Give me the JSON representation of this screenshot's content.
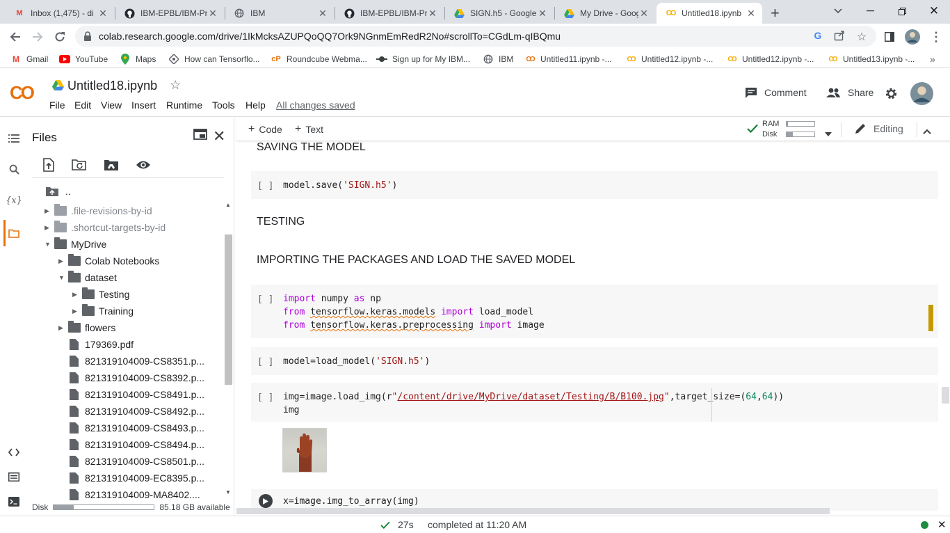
{
  "browser": {
    "tabs": [
      {
        "label": "Inbox (1,475) - di",
        "icon": "gmail-icon"
      },
      {
        "label": "IBM-EPBL/IBM-Pr",
        "icon": "github-icon"
      },
      {
        "label": "IBM",
        "icon": "globe-icon"
      },
      {
        "label": "IBM-EPBL/IBM-Pr",
        "icon": "github-icon"
      },
      {
        "label": "SIGN.h5 - Google",
        "icon": "drive-icon"
      },
      {
        "label": "My Drive - Googl",
        "icon": "drive-icon"
      },
      {
        "label": "Untitled18.ipynb",
        "icon": "colab-icon",
        "active": true
      }
    ],
    "url": "colab.research.google.com/drive/1IkMcksAZUPQoQQ7Ork9NGnmEmRedR2No#scrollTo=CGdLm-qIBQmu"
  },
  "bookmarks": [
    {
      "label": "Gmail",
      "icon": "gmail-icon"
    },
    {
      "label": "YouTube",
      "icon": "youtube-icon"
    },
    {
      "label": "Maps",
      "icon": "maps-icon"
    },
    {
      "label": "How can Tensorflo...",
      "icon": "tensorflow-icon"
    },
    {
      "label": "Roundcube Webma...",
      "icon": "roundcube-icon"
    },
    {
      "label": "Sign up for My IBM...",
      "icon": "ibm-icon"
    },
    {
      "label": "IBM",
      "icon": "globe-icon"
    },
    {
      "label": "Untitled11.ipynb -...",
      "icon": "colab-icon"
    },
    {
      "label": "Untitled12.ipynb -...",
      "icon": "colab-icon"
    },
    {
      "label": "Untitled12.ipynb -...",
      "icon": "colab-icon"
    },
    {
      "label": "Untitled13.ipynb -...",
      "icon": "colab-icon"
    }
  ],
  "colab": {
    "logo": "CO",
    "title": "Untitled18.ipynb",
    "menu": [
      "File",
      "Edit",
      "View",
      "Insert",
      "Runtime",
      "Tools",
      "Help"
    ],
    "saved_status": "All changes saved",
    "comment_label": "Comment",
    "share_label": "Share"
  },
  "files": {
    "title": "Files",
    "parent": "..",
    "tree": [
      {
        "label": ".file-revisions-by-id",
        "type": "folder",
        "depth": 0,
        "expanded": false,
        "dim": true
      },
      {
        "label": ".shortcut-targets-by-id",
        "type": "folder",
        "depth": 0,
        "expanded": false,
        "dim": true
      },
      {
        "label": "MyDrive",
        "type": "folder",
        "depth": 0,
        "expanded": true
      },
      {
        "label": "Colab Notebooks",
        "type": "folder",
        "depth": 1,
        "expanded": false
      },
      {
        "label": "dataset",
        "type": "folder",
        "depth": 1,
        "expanded": true
      },
      {
        "label": "Testing",
        "type": "folder",
        "depth": 2,
        "expanded": false
      },
      {
        "label": "Training",
        "type": "folder",
        "depth": 2,
        "expanded": false
      },
      {
        "label": "flowers",
        "type": "folder",
        "depth": 1,
        "expanded": false
      },
      {
        "label": "179369.pdf",
        "type": "file",
        "depth": 1
      },
      {
        "label": "821319104009-CS8351.p...",
        "type": "file",
        "depth": 1
      },
      {
        "label": "821319104009-CS8392.p...",
        "type": "file",
        "depth": 1
      },
      {
        "label": "821319104009-CS8491.p...",
        "type": "file",
        "depth": 1
      },
      {
        "label": "821319104009-CS8492.p...",
        "type": "file",
        "depth": 1
      },
      {
        "label": "821319104009-CS8493.p...",
        "type": "file",
        "depth": 1
      },
      {
        "label": "821319104009-CS8494.p...",
        "type": "file",
        "depth": 1
      },
      {
        "label": "821319104009-CS8501.p...",
        "type": "file",
        "depth": 1
      },
      {
        "label": "821319104009-EC8395.p...",
        "type": "file",
        "depth": 1
      },
      {
        "label": "821319104009-MA8402....",
        "type": "file",
        "depth": 1
      }
    ],
    "disk_label": "Disk",
    "disk_fraction": 0.2,
    "disk_available": "85.18 GB available"
  },
  "toolbar": {
    "code_label": "Code",
    "text_label": "Text",
    "ram_label": "RAM",
    "disk_label": "Disk",
    "ram_fraction": 0.04,
    "disk_fraction": 0.22,
    "editing_label": "Editing"
  },
  "notebook": {
    "heading_save": "SAVING THE MODEL",
    "heading_testing": "TESTING",
    "heading_import": "IMPORTING THE PACKAGES AND LOAD THE SAVED MODEL",
    "cell_bracket": "[ ]",
    "cell1": {
      "text": "model.save(",
      "str": "'SIGN.h5'",
      "end": ")"
    },
    "cell2": {
      "l1_kw1": "import",
      "l1_a": " numpy ",
      "l1_kw2": "as",
      "l1_b": " np",
      "l2_kw1": "from",
      "l2_mod": "tensorflow.keras.models",
      "l2_kw2": "import",
      "l2_b": " load_model",
      "l3_kw1": "from",
      "l3_mod": "tensorflow.keras.preprocessing",
      "l3_kw2": "import",
      "l3_b": " image"
    },
    "cell3": {
      "text": "model=load_model(",
      "str": "'SIGN.h5'",
      "end": ")"
    },
    "cell4": {
      "a": "img=image.load_img(r",
      "q1": "\"",
      "path": "/content/drive/MyDrive/dataset/Testing/B/B100.jpg",
      "q2": "\"",
      "b": ",target_size=(",
      "n1": "64",
      "c": ",",
      "n2": "64",
      "d": "))",
      "line2": "img"
    },
    "cell5": {
      "text": "x=image.img_to_array(img)"
    }
  },
  "status": {
    "elapsed": "27s",
    "completed": "completed at 11:20 AM"
  },
  "colors": {
    "colab_orange": "#f9ab00",
    "colab_dark_orange": "#e8710a",
    "keyword": "#af00db",
    "string": "#a31515",
    "number": "#098658",
    "ok_green": "#188038"
  }
}
